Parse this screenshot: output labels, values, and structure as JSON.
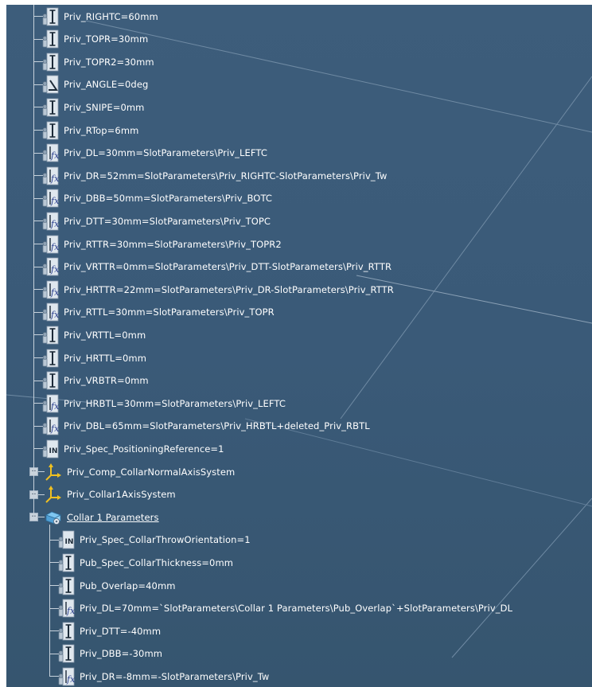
{
  "tree": {
    "parameters_top": [
      {
        "label": "Priv_RIGHTC=60mm",
        "icon": "length-parameter-icon"
      },
      {
        "label": "Priv_TOPR=30mm",
        "icon": "length-parameter-icon"
      },
      {
        "label": "Priv_TOPR2=30mm",
        "icon": "length-parameter-icon"
      },
      {
        "label": "Priv_ANGLE=0deg",
        "icon": "angle-parameter-icon"
      },
      {
        "label": "Priv_SNIPE=0mm",
        "icon": "length-parameter-icon"
      },
      {
        "label": "Priv_RTop=6mm",
        "icon": "length-parameter-icon"
      },
      {
        "label": "Priv_DL=30mm=SlotParameters\\Priv_LEFTC",
        "icon": "formula-parameter-icon"
      },
      {
        "label": "Priv_DR=52mm=SlotParameters\\Priv_RIGHTC-SlotParameters\\Priv_Tw",
        "icon": "formula-parameter-icon"
      },
      {
        "label": "Priv_DBB=50mm=SlotParameters\\Priv_BOTC",
        "icon": "formula-parameter-icon"
      },
      {
        "label": "Priv_DTT=30mm=SlotParameters\\Priv_TOPC",
        "icon": "formula-parameter-icon"
      },
      {
        "label": "Priv_RTTR=30mm=SlotParameters\\Priv_TOPR2",
        "icon": "formula-parameter-icon"
      },
      {
        "label": "Priv_VRTTR=0mm=SlotParameters\\Priv_DTT-SlotParameters\\Priv_RTTR",
        "icon": "formula-parameter-icon"
      },
      {
        "label": "Priv_HRTTR=22mm=SlotParameters\\Priv_DR-SlotParameters\\Priv_RTTR",
        "icon": "formula-parameter-icon"
      },
      {
        "label": "Priv_RTTL=30mm=SlotParameters\\Priv_TOPR",
        "icon": "formula-parameter-icon"
      },
      {
        "label": "Priv_VRTTL=0mm",
        "icon": "length-parameter-icon"
      },
      {
        "label": "Priv_HRTTL=0mm",
        "icon": "length-parameter-icon"
      },
      {
        "label": "Priv_VRBTR=0mm",
        "icon": "length-parameter-icon"
      },
      {
        "label": "Priv_HRBTL=30mm=SlotParameters\\Priv_LEFTC",
        "icon": "formula-parameter-icon"
      },
      {
        "label": "Priv_DBL=65mm=SlotParameters\\Priv_HRBTL+deleted_Priv_RBTL",
        "icon": "formula-parameter-icon"
      },
      {
        "label": "Priv_Spec_PositioningReference=1",
        "icon": "integer-parameter-icon"
      }
    ],
    "axis_systems": [
      {
        "label": "Priv_Comp_CollarNormalAxisSystem",
        "icon": "axis-system-icon",
        "expander": "+"
      },
      {
        "label": "Priv_Collar1AxisSystem",
        "icon": "axis-system-icon",
        "expander": "+"
      }
    ],
    "collar_set": {
      "label": "Collar 1 Parameters",
      "icon": "parameter-set-icon",
      "expander": "−"
    },
    "collar_children": [
      {
        "label": "Priv_Spec_CollarThrowOrientation=1",
        "icon": "integer-parameter-icon"
      },
      {
        "label": "Pub_Spec_CollarThickness=0mm",
        "icon": "length-parameter-icon"
      },
      {
        "label": "Pub_Overlap=40mm",
        "icon": "length-parameter-icon"
      },
      {
        "label": "Priv_DL=70mm=`SlotParameters\\Collar 1 Parameters\\Pub_Overlap`+SlotParameters\\Priv_DL",
        "icon": "formula-parameter-icon"
      },
      {
        "label": "Priv_DTT=-40mm",
        "icon": "length-parameter-icon"
      },
      {
        "label": "Priv_DBB=-30mm",
        "icon": "length-parameter-icon"
      },
      {
        "label": "Priv_DR=-8mm=-SlotParameters\\Priv_Tw",
        "icon": "formula-parameter-icon"
      }
    ]
  },
  "colors": {
    "background": "#3a5a78",
    "tree_line": "#c6d1db",
    "text": "#ffffff"
  }
}
